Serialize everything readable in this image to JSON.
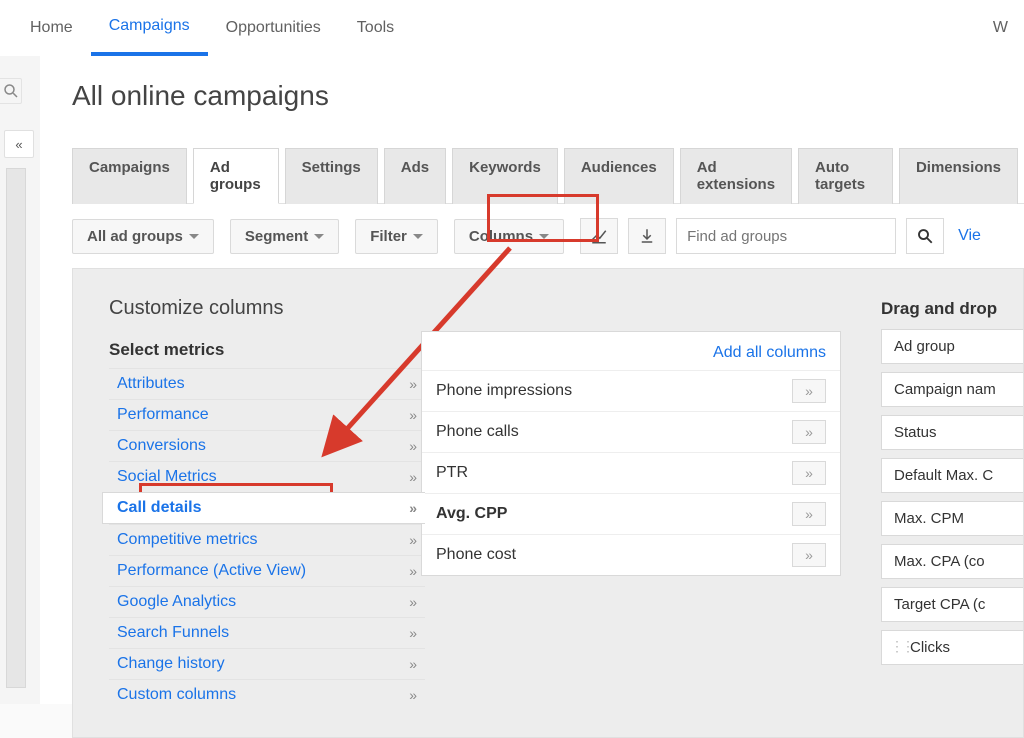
{
  "topnav": {
    "items": [
      "Home",
      "Campaigns",
      "Opportunities",
      "Tools"
    ],
    "active": 1,
    "right_char": "W"
  },
  "page_title": "All online campaigns",
  "tabs": {
    "items": [
      "Campaigns",
      "Ad groups",
      "Settings",
      "Ads",
      "Keywords",
      "Audiences",
      "Ad extensions",
      "Auto targets",
      "Dimensions"
    ],
    "active": 1
  },
  "toolbar": {
    "all_ad_groups": "All ad groups",
    "segment": "Segment",
    "filter": "Filter",
    "columns": "Columns",
    "search_placeholder": "Find ad groups",
    "view_link": "Vie"
  },
  "panel": {
    "title": "Customize columns",
    "select_metrics": "Select metrics",
    "metrics": [
      "Attributes",
      "Performance",
      "Conversions",
      "Social Metrics",
      "Call details",
      "Competitive metrics",
      "Performance (Active View)",
      "Google Analytics",
      "Search Funnels",
      "Change history",
      "Custom columns"
    ],
    "metrics_selected": 4,
    "add_all": "Add all columns",
    "available_columns": [
      {
        "label": "Phone impressions",
        "bold": false
      },
      {
        "label": "Phone calls",
        "bold": false
      },
      {
        "label": "PTR",
        "bold": false
      },
      {
        "label": "Avg. CPP",
        "bold": true
      },
      {
        "label": "Phone cost",
        "bold": false
      }
    ],
    "dragdrop_title": "Drag and drop",
    "dragdrop_items": [
      {
        "label": "Ad group",
        "draggable": false
      },
      {
        "label": "Campaign nam",
        "draggable": false
      },
      {
        "label": "Status",
        "draggable": false
      },
      {
        "label": "Default Max. C",
        "draggable": false
      },
      {
        "label": "Max. CPM",
        "draggable": false
      },
      {
        "label": "Max. CPA (co",
        "draggable": false
      },
      {
        "label": "Target CPA (c",
        "draggable": false
      },
      {
        "label": "Clicks",
        "draggable": true
      }
    ]
  }
}
